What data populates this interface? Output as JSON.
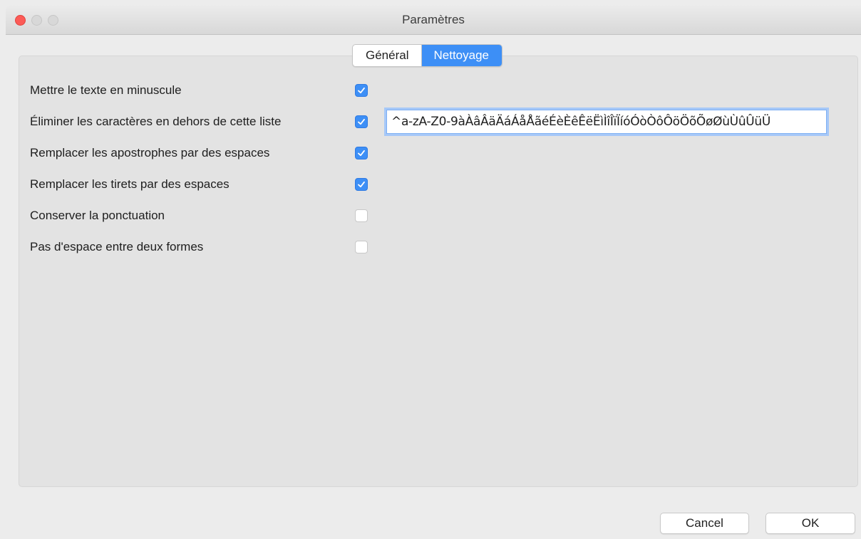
{
  "window": {
    "title": "Paramètres"
  },
  "tabs": [
    {
      "label": "Général",
      "active": false
    },
    {
      "label": "Nettoyage",
      "active": true
    }
  ],
  "options": [
    {
      "label": "Mettre le texte en minuscule",
      "checked": true
    },
    {
      "label": "Éliminer les caractères en dehors de cette liste",
      "checked": true
    },
    {
      "label": "Remplacer les apostrophes par des espaces",
      "checked": true
    },
    {
      "label": "Remplacer les tirets par des espaces",
      "checked": true
    },
    {
      "label": "Conserver la ponctuation",
      "checked": false
    },
    {
      "label": "Pas d'espace entre deux formes",
      "checked": false
    }
  ],
  "allowed_chars_field": {
    "value": "^a-zA-Z0-9àÀâÂäÄáÁåÅãéÉèÈêÊëËìÌîÎïÏíóÓòÒôÔöÖõÕøØùÙûÛüÜ"
  },
  "buttons": {
    "cancel": "Cancel",
    "ok": "OK"
  },
  "colors": {
    "accent": "#3d8ff6",
    "close": "#fc5b57"
  }
}
